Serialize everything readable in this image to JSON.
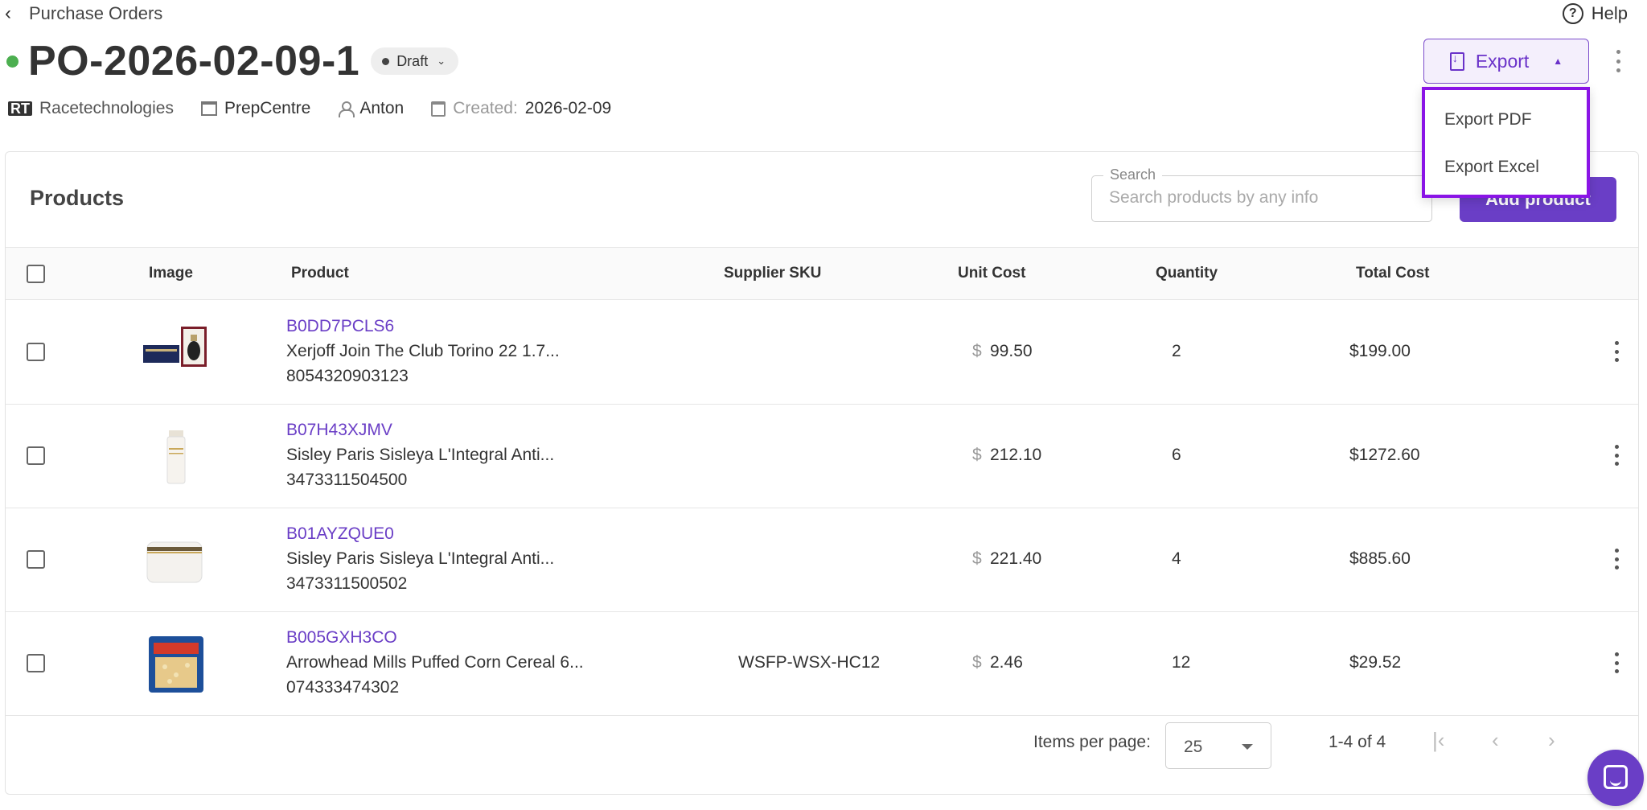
{
  "header": {
    "back_label": "Purchase Orders",
    "help_label": "Help",
    "po_number": "PO-2026-02-09-1",
    "status": "Draft",
    "status_color": "#4caf50",
    "supplier": "Racetechnologies",
    "warehouse": "PrepCentre",
    "user": "Anton",
    "created_label": "Created:",
    "created_date": "2026-02-09",
    "export_label": "Export"
  },
  "export_menu": {
    "items": [
      {
        "label": "Export PDF"
      },
      {
        "label": "Export Excel"
      }
    ]
  },
  "products": {
    "title": "Products",
    "search_legend": "Search",
    "search_placeholder": "Search products by any info",
    "add_button": "Add product",
    "columns": {
      "image": "Image",
      "product": "Product",
      "supplier_sku": "Supplier SKU",
      "unit_cost": "Unit Cost",
      "quantity": "Quantity",
      "total_cost": "Total Cost"
    },
    "rows": [
      {
        "asin": "B0DD7PCLS6",
        "name": "Xerjoff Join The Club Torino 22 1.7...",
        "barcode": "8054320903123",
        "sku": "",
        "currency": "$",
        "unit_cost": "99.50",
        "quantity": "2",
        "total": "$199.00"
      },
      {
        "asin": "B07H43XJMV",
        "name": "Sisley Paris Sisleya L'Integral Anti...",
        "barcode": "3473311504500",
        "sku": "",
        "currency": "$",
        "unit_cost": "212.10",
        "quantity": "6",
        "total": "$1272.60"
      },
      {
        "asin": "B01AYZQUE0",
        "name": "Sisley Paris Sisleya L'Integral Anti...",
        "barcode": "3473311500502",
        "sku": "",
        "currency": "$",
        "unit_cost": "221.40",
        "quantity": "4",
        "total": "$885.60"
      },
      {
        "asin": "B005GXH3CO",
        "name": "Arrowhead Mills Puffed Corn Cereal 6...",
        "barcode": "074333474302",
        "sku": "WSFP-WSX-HC12",
        "currency": "$",
        "unit_cost": "2.46",
        "quantity": "12",
        "total": "$29.52"
      }
    ]
  },
  "pagination": {
    "items_per_page_label": "Items per page:",
    "items_per_page": "25",
    "range": "1-4 of 4"
  },
  "colors": {
    "accent": "#6a3ec6",
    "dropdown_highlight": "#8a14e6"
  }
}
